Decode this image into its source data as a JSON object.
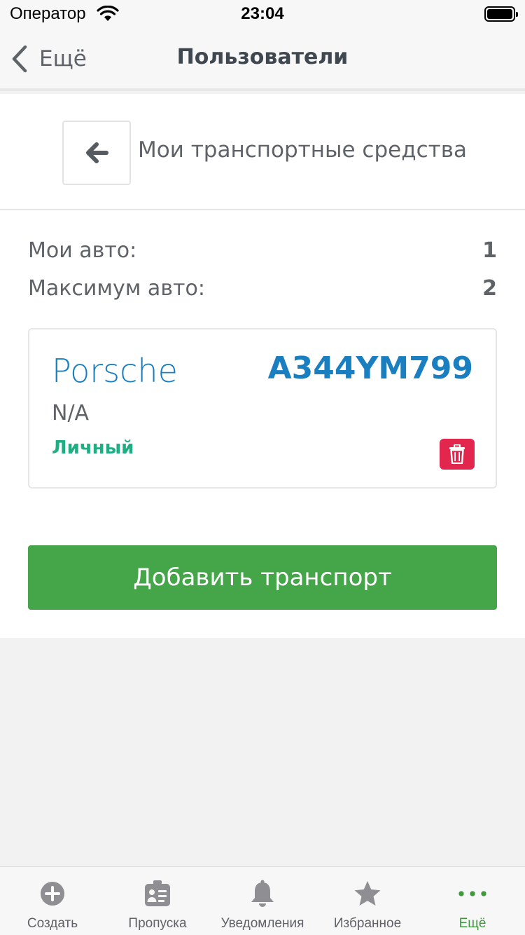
{
  "status_bar": {
    "carrier": "Оператор",
    "time": "23:04"
  },
  "nav": {
    "back_label": "Ещё",
    "title": "Пользователи"
  },
  "section": {
    "title": "Мои транспортные средства"
  },
  "stats": [
    {
      "label": "Мои авто:",
      "value": "1"
    },
    {
      "label": "Максимум авто:",
      "value": "2"
    }
  ],
  "vehicle": {
    "brand": "Porsche",
    "plate": "A344YM799",
    "model": "N/A",
    "type": "Личный"
  },
  "add_button": {
    "label": "Добавить транспорт"
  },
  "tabs": [
    {
      "label": "Создать",
      "icon": "plus-circle-icon",
      "active": false
    },
    {
      "label": "Пропуска",
      "icon": "badge-icon",
      "active": false
    },
    {
      "label": "Уведомления",
      "icon": "bell-icon",
      "active": false
    },
    {
      "label": "Избранное",
      "icon": "star-icon",
      "active": false
    },
    {
      "label": "Ещё",
      "icon": "more-dots-icon",
      "active": true
    }
  ],
  "colors": {
    "accent_blue": "#1a7fc1",
    "accent_green": "#45a549",
    "type_green": "#1fae84",
    "danger_red": "#e3264d",
    "tab_active": "#3f9a3f",
    "tab_inactive": "#8e8e93"
  }
}
